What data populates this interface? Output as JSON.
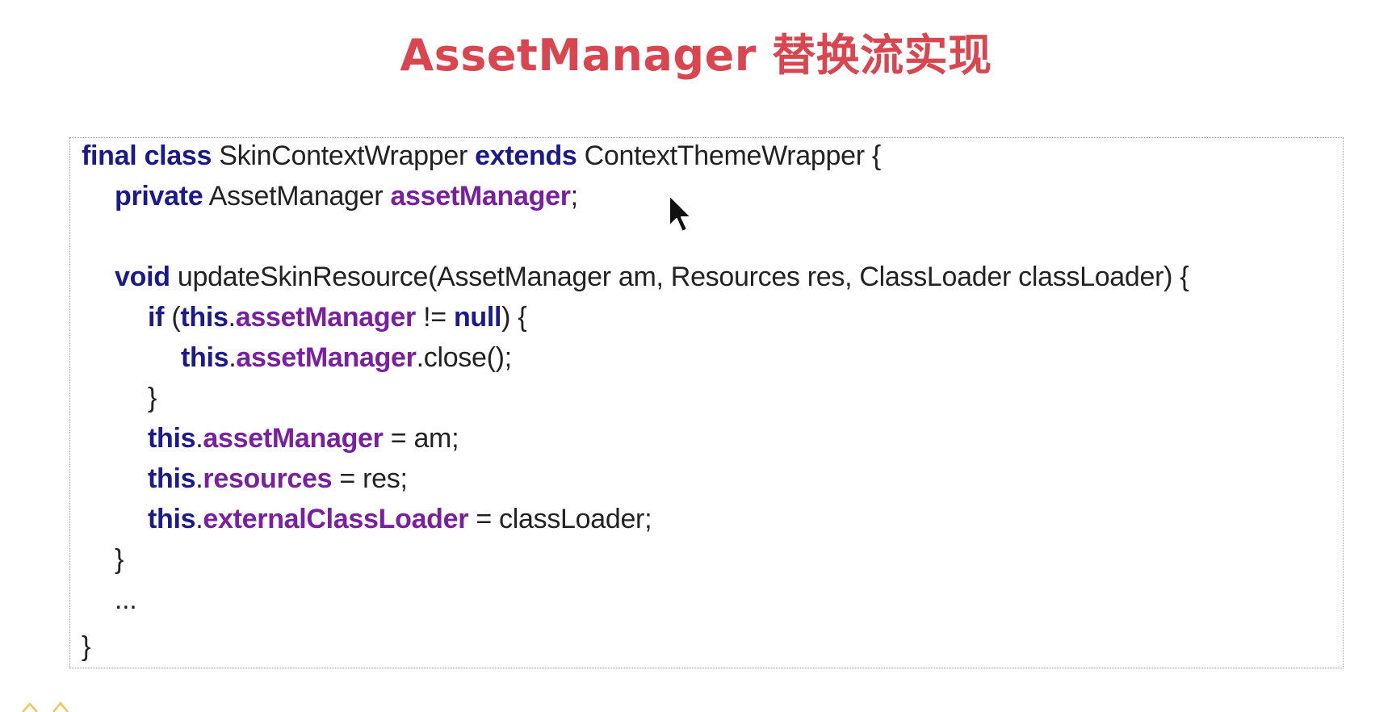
{
  "slide": {
    "title": "AssetManager 替换流实现"
  },
  "colors": {
    "title": "#d9464f",
    "keyword": "#1a1a8c",
    "field": "#7a1fa0",
    "text": "#222222",
    "border": "#9a9a9a"
  },
  "code_lines": [
    {
      "indent": 0,
      "tokens": [
        {
          "t": "final",
          "k": "kw"
        },
        {
          "t": " ",
          "k": "txt"
        },
        {
          "t": "class",
          "k": "kw"
        },
        {
          "t": " SkinContextWrapper ",
          "k": "txt"
        },
        {
          "t": "extends",
          "k": "kw"
        },
        {
          "t": " ContextThemeWrapper {",
          "k": "txt"
        }
      ]
    },
    {
      "indent": 1,
      "tokens": [
        {
          "t": "private",
          "k": "kw"
        },
        {
          "t": " AssetManager ",
          "k": "txt"
        },
        {
          "t": "assetManager",
          "k": "fld"
        },
        {
          "t": ";",
          "k": "txt"
        }
      ]
    },
    {
      "indent": 0,
      "tokens": []
    },
    {
      "indent": 1,
      "tokens": [
        {
          "t": "void",
          "k": "kw"
        },
        {
          "t": " updateSkinResource(AssetManager am, Resources res, ClassLoader classLoader) {",
          "k": "txt"
        }
      ]
    },
    {
      "indent": 2,
      "tokens": [
        {
          "t": "if",
          "k": "kw"
        },
        {
          "t": " (",
          "k": "txt"
        },
        {
          "t": "this",
          "k": "kw"
        },
        {
          "t": ".",
          "k": "txt"
        },
        {
          "t": "assetManager",
          "k": "fld"
        },
        {
          "t": " != ",
          "k": "txt"
        },
        {
          "t": "null",
          "k": "kw"
        },
        {
          "t": ") {",
          "k": "txt"
        }
      ]
    },
    {
      "indent": 3,
      "tokens": [
        {
          "t": "this",
          "k": "kw"
        },
        {
          "t": ".",
          "k": "txt"
        },
        {
          "t": "assetManager",
          "k": "fld"
        },
        {
          "t": ".close();",
          "k": "txt"
        }
      ]
    },
    {
      "indent": 2,
      "tokens": [
        {
          "t": "}",
          "k": "txt"
        }
      ]
    },
    {
      "indent": 2,
      "tokens": [
        {
          "t": "this",
          "k": "kw"
        },
        {
          "t": ".",
          "k": "txt"
        },
        {
          "t": "assetManager",
          "k": "fld"
        },
        {
          "t": " = am;",
          "k": "txt"
        }
      ]
    },
    {
      "indent": 2,
      "tokens": [
        {
          "t": "this",
          "k": "kw"
        },
        {
          "t": ".",
          "k": "txt"
        },
        {
          "t": "resources",
          "k": "fld"
        },
        {
          "t": " = res;",
          "k": "txt"
        }
      ]
    },
    {
      "indent": 2,
      "tokens": [
        {
          "t": "this",
          "k": "kw"
        },
        {
          "t": ".",
          "k": "txt"
        },
        {
          "t": "externalClassLoader",
          "k": "fld"
        },
        {
          "t": " = classLoader;",
          "k": "txt"
        }
      ]
    },
    {
      "indent": 1,
      "tokens": [
        {
          "t": "}",
          "k": "txt"
        }
      ]
    },
    {
      "indent": 1,
      "tokens": [
        {
          "t": "...",
          "k": "txt"
        }
      ]
    },
    {
      "indent": 0,
      "tokens": [
        {
          "t": "}",
          "k": "txt"
        }
      ]
    }
  ]
}
